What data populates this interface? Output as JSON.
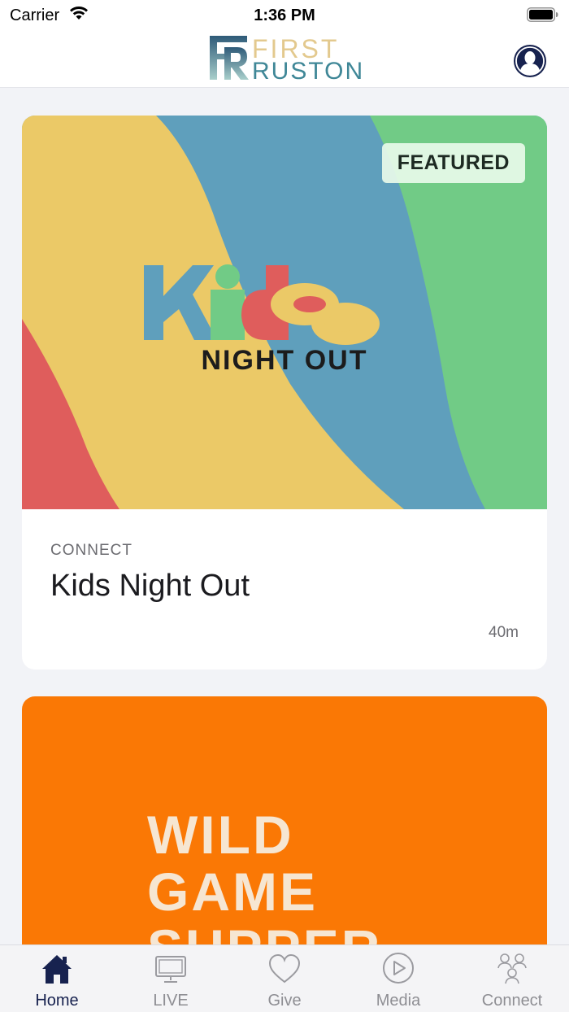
{
  "status_bar": {
    "carrier": "Carrier",
    "time": "1:36 PM"
  },
  "header": {
    "logo_word_1": "FIRST",
    "logo_word_2": "RUSTON",
    "logo_monogram": "FR",
    "accent": "#17224f"
  },
  "feed": {
    "cards": [
      {
        "badge": "FEATURED",
        "image_lettering": "kids NIGHT OUT",
        "category": "CONNECT",
        "title": "Kids Night Out",
        "duration": "40m"
      },
      {
        "image_lettering": "WILD GAME SUPPER",
        "image_color": "#fa7805"
      }
    ]
  },
  "tab_bar": {
    "tabs": [
      {
        "label": "Home",
        "icon": "home-icon",
        "active": true
      },
      {
        "label": "LIVE",
        "icon": "tv-icon",
        "active": false
      },
      {
        "label": "Give",
        "icon": "heart-icon",
        "active": false
      },
      {
        "label": "Media",
        "icon": "play-circle-icon",
        "active": false
      },
      {
        "label": "Connect",
        "icon": "people-icon",
        "active": false
      }
    ]
  }
}
